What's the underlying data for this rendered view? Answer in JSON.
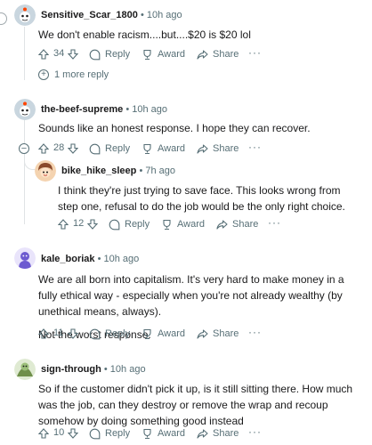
{
  "labels": {
    "reply": "Reply",
    "award": "Award",
    "share": "Share",
    "more": "···"
  },
  "comments": [
    {
      "user": "Sensitive_Scar_1800",
      "time": "• 10h ago",
      "body": [
        "We don't enable racism....but....$20 is $20 lol"
      ],
      "votes": "34",
      "more_replies": "1 more reply",
      "avatar_color": "#c9d6df"
    },
    {
      "user": "the-beef-supreme",
      "time": "• 10h ago",
      "body": [
        "Sounds like an honest response. I hope they can recover."
      ],
      "votes": "28",
      "avatar_color": "#c9d6df"
    },
    {
      "user": "bike_hike_sleep",
      "time": "• 7h ago",
      "body": [
        "I think they're just trying to save face. This looks wrong from step one, refusal to do the job would be the only right choice."
      ],
      "votes": "12",
      "avatar_color": "#f4d3b0"
    },
    {
      "user": "kale_boriak",
      "time": "• 10h ago",
      "body": [
        "We are all born into capitalism. It's very hard to make money in a fully ethical way - especially when you're not already wealthy (by unethical means, always).",
        "Not the worst response."
      ],
      "votes": "11",
      "avatar_color": "#6d5bd0"
    },
    {
      "user": "sign-through",
      "time": "• 10h ago",
      "body": [
        "So if the customer didn't pick it up, is it still sitting there. How much was the job, can they destroy or remove the wrap and recoup somehow by doing something good instead"
      ],
      "votes": "10",
      "avatar_color": "#9bbf7a"
    }
  ]
}
